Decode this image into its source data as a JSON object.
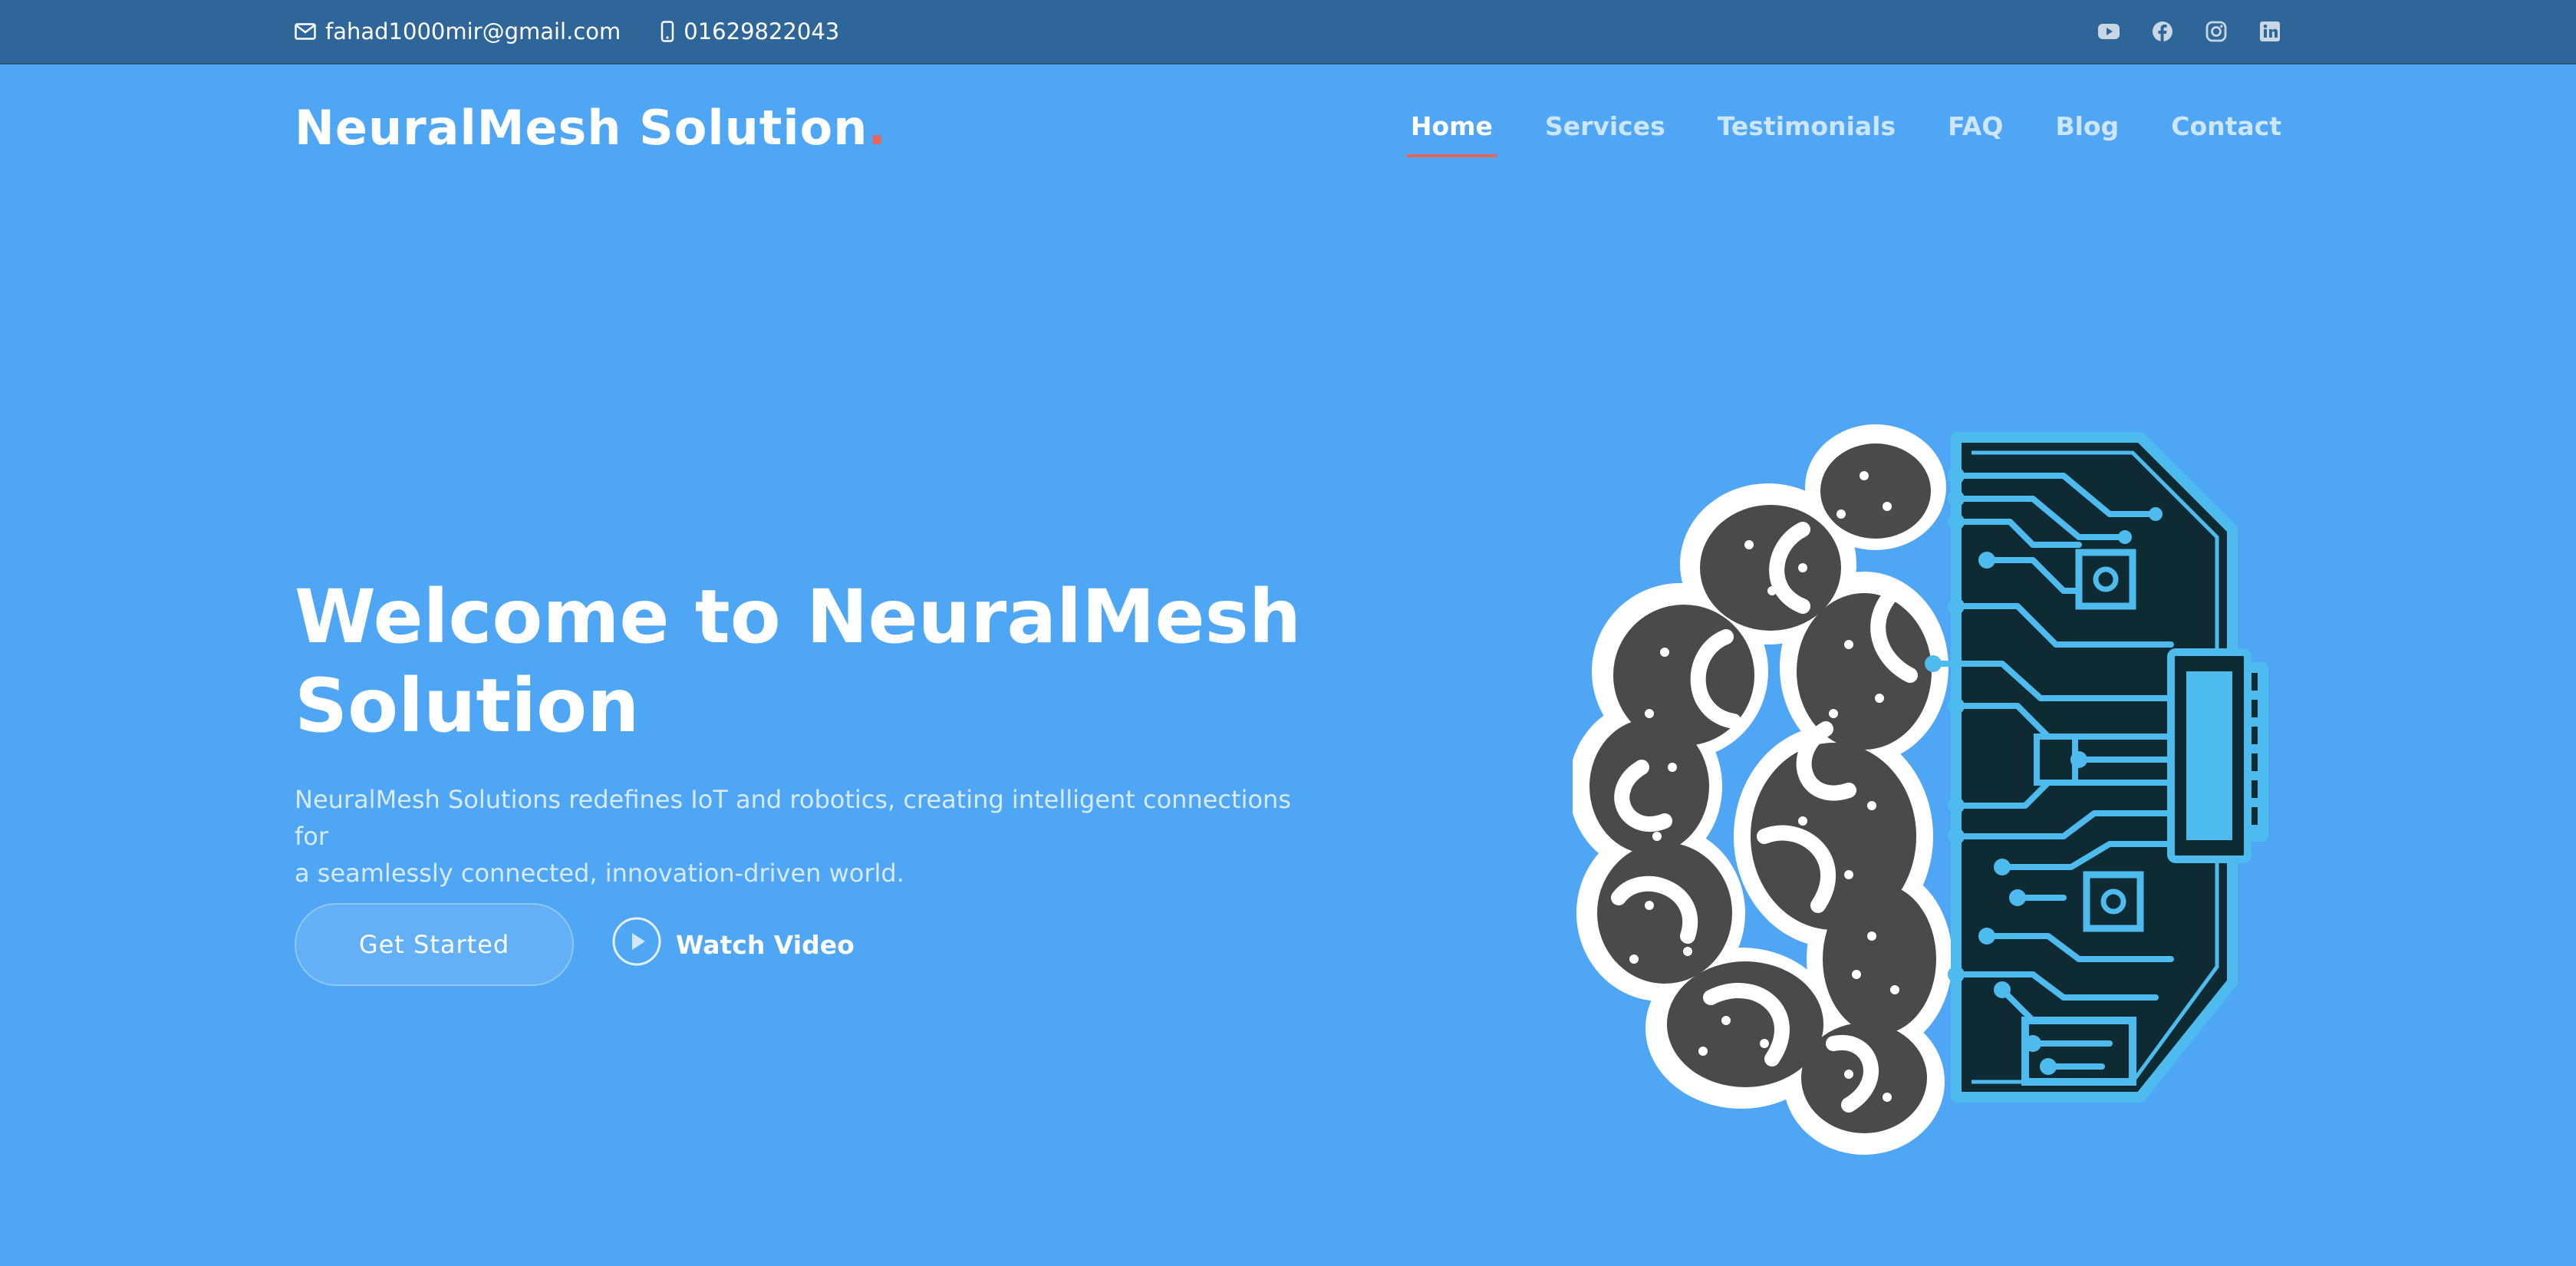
{
  "topbar": {
    "email": "fahad1000mir@gmail.com",
    "phone": "01629822043",
    "social_icons": [
      "youtube-icon",
      "facebook-icon",
      "instagram-icon",
      "linkedin-icon"
    ]
  },
  "brand": {
    "name": "NeuralMesh Solution",
    "dot": "."
  },
  "nav": {
    "items": [
      {
        "label": "Home",
        "active": true
      },
      {
        "label": "Services"
      },
      {
        "label": "Testimonials"
      },
      {
        "label": "FAQ"
      },
      {
        "label": "Blog"
      },
      {
        "label": "Contact"
      }
    ]
  },
  "hero": {
    "title_line1": "Welcome to NeuralMesh",
    "title_line2": "Solution",
    "description_line1": "NeuralMesh Solutions redefines IoT and robotics, creating intelligent connections for",
    "description_line2": "a seamlessly connected, innovation-driven world.",
    "primary_button": "Get Started",
    "video_button": "Watch Video"
  },
  "colors": {
    "background": "#4ea6f5",
    "topbar": "#2f6699",
    "accent": "#e8655a",
    "circuit": "#4dbbee",
    "circuit_dark": "#0e2a33",
    "brain": "#4a4a4a"
  }
}
